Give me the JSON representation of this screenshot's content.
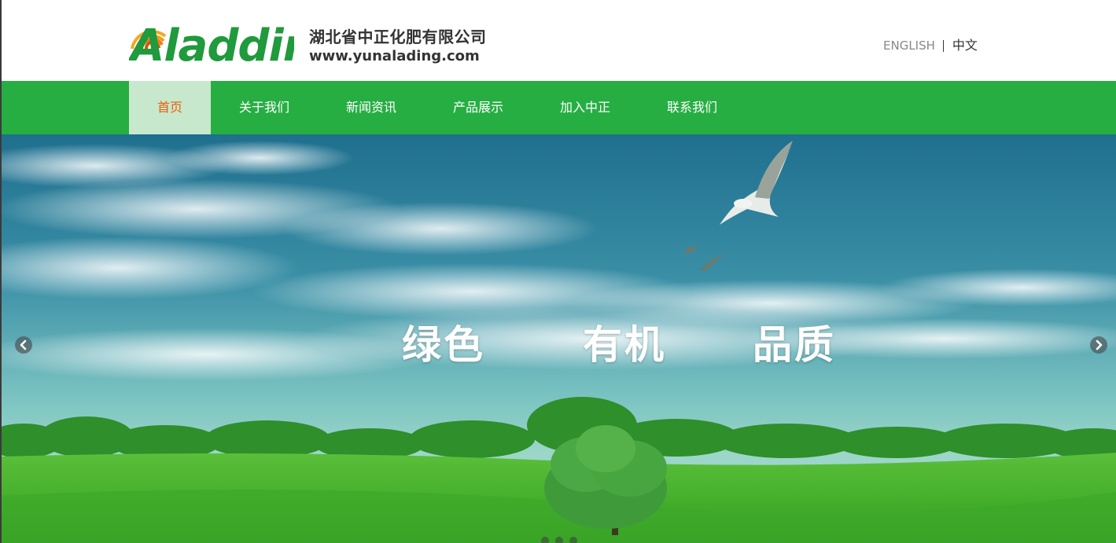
{
  "header": {
    "logo_text": "Aladdin",
    "company_name": "湖北省中正化肥有限公司",
    "company_url": "www.yunalading.com"
  },
  "language": {
    "english": "ENGLISH",
    "chinese": "中文"
  },
  "nav": {
    "items": [
      {
        "label": "首页",
        "active": true
      },
      {
        "label": "关于我们",
        "active": false
      },
      {
        "label": "新闻资讯",
        "active": false
      },
      {
        "label": "产品展示",
        "active": false
      },
      {
        "label": "加入中正",
        "active": false
      },
      {
        "label": "联系我们",
        "active": false
      }
    ]
  },
  "banner": {
    "slogan": [
      "绿色",
      "有机",
      "品质"
    ],
    "slide_count": 3,
    "active_slide": 1
  },
  "colors": {
    "nav_green": "#26ae43",
    "active_bg": "#c8e8cd",
    "active_text": "#e8610d",
    "logo_green": "#1f9a3c",
    "logo_orange": "#f39c12"
  }
}
